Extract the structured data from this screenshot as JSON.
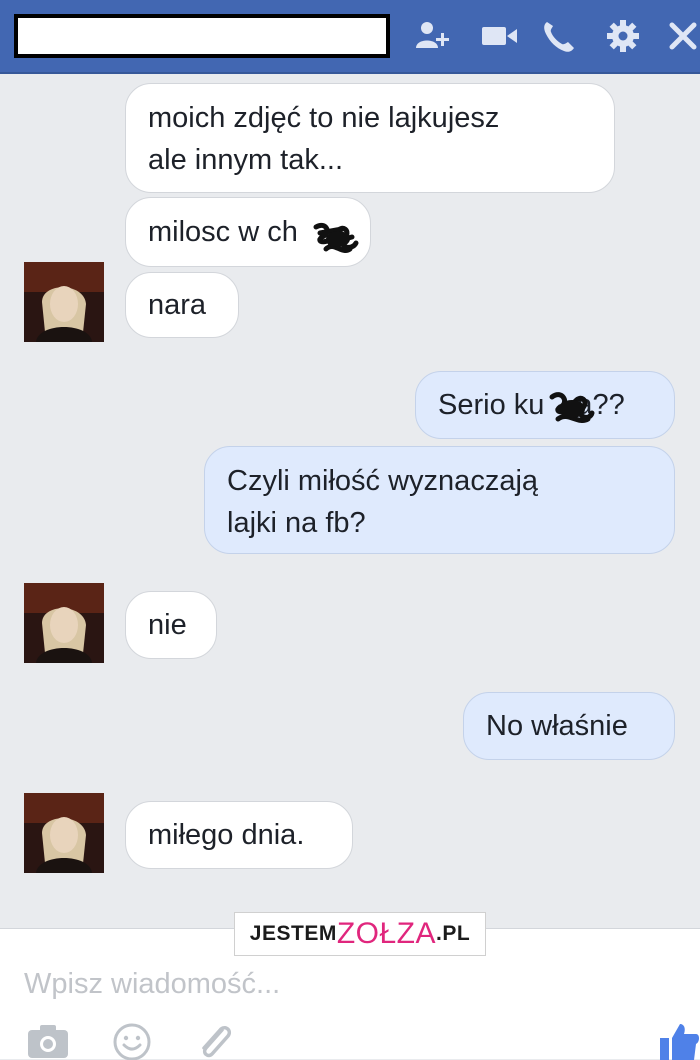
{
  "colors": {
    "header": "#4267b2",
    "incoming_bubble": "#ffffff",
    "outgoing_bubble": "#dfeafd",
    "background": "#e9ebee",
    "watermark_accent": "#e0267d"
  },
  "header": {
    "conversation_title": "",
    "icons": [
      "add-people-icon",
      "video-call-icon",
      "phone-icon",
      "gear-icon",
      "close-icon"
    ]
  },
  "messages": [
    {
      "direction": "in",
      "lines": [
        "moich zdjęć to nie lajkujesz",
        "ale innym tak..."
      ]
    },
    {
      "direction": "in",
      "text": "milosc w ch",
      "redacted": true
    },
    {
      "direction": "in",
      "text": "nara"
    },
    {
      "direction": "out",
      "text_before": "Serio ku",
      "text_after": "a??",
      "redacted": true
    },
    {
      "direction": "out",
      "lines": [
        "Czyli miłość wyznaczają",
        "lajki na fb?"
      ]
    },
    {
      "direction": "in",
      "text": "nie"
    },
    {
      "direction": "out",
      "text": "No właśnie"
    },
    {
      "direction": "in",
      "text": "miłego dnia."
    }
  ],
  "watermark": {
    "part1": "JESTEM",
    "part2": "ZOŁZA",
    "part3": ".PL"
  },
  "composer": {
    "placeholder": "Wpisz wiadomość...",
    "icons": [
      "camera-icon",
      "emoji-icon",
      "attachment-icon",
      "like-icon"
    ]
  }
}
